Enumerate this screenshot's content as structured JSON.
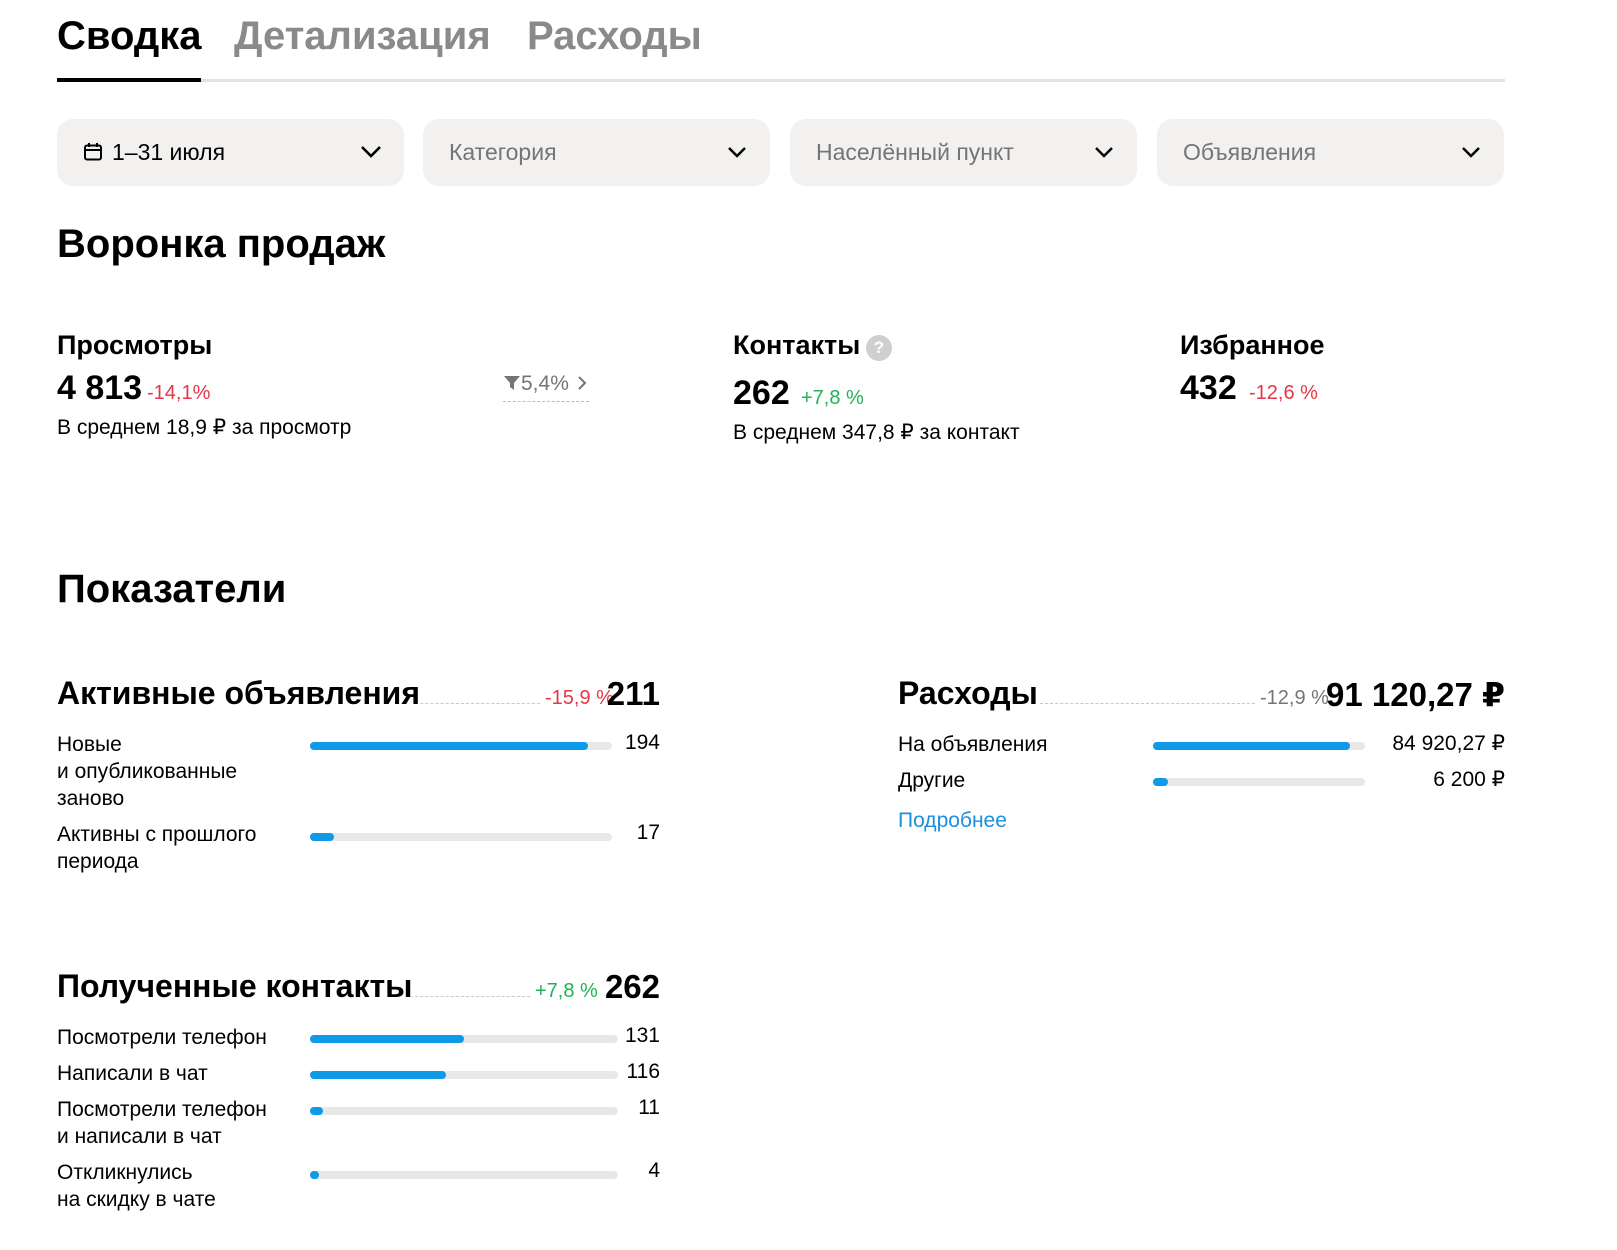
{
  "tabs": [
    {
      "label": "Сводка",
      "active": true
    },
    {
      "label": "Детализация",
      "active": false
    },
    {
      "label": "Расходы",
      "active": false
    }
  ],
  "filters": {
    "date": "1–31 июля",
    "category_placeholder": "Категория",
    "city_placeholder": "Населённый пункт",
    "ads_placeholder": "Объявления"
  },
  "funnel": {
    "title": "Воронка продаж",
    "views": {
      "title": "Просмотры",
      "value": "4 813",
      "change": "-14,1%",
      "avg": "В среднем 18,9 ₽ за просмотр",
      "conversion": "5,4%"
    },
    "contacts": {
      "title": "Контакты",
      "help": "?",
      "value": "262",
      "change": "+7,8 %",
      "avg": "В среднем 347,8 ₽ за контакт"
    },
    "favorites": {
      "title": "Избранное",
      "value": "432",
      "change": "-12,6 %"
    }
  },
  "indicators": {
    "title": "Показатели",
    "active_ads": {
      "title": "Активные объявления",
      "change": "-15,9 %",
      "value": "211",
      "rows": [
        {
          "label1": "Новые",
          "label2": "и опубликованные",
          "label3": "заново",
          "value": "194",
          "fraction": 0.92
        },
        {
          "label1": "Активны с прошлого",
          "label2": "периода",
          "value": "17",
          "fraction": 0.08
        }
      ]
    },
    "expenses": {
      "title": "Расходы",
      "change": "-12,9 %",
      "value": "91 120,27 ₽",
      "rows": [
        {
          "label": "На объявления",
          "value": "84 920,27 ₽",
          "fraction": 0.93
        },
        {
          "label": "Другие",
          "value": "6 200 ₽",
          "fraction": 0.07
        }
      ],
      "more_link": "Подробнее"
    },
    "contacts": {
      "title": "Полученные контакты",
      "change": "+7,8 %",
      "value": "262",
      "rows": [
        {
          "label1": "Посмотрели телефон",
          "value": "131",
          "fraction": 0.5
        },
        {
          "label1": "Написали в чат",
          "value": "116",
          "fraction": 0.443
        },
        {
          "label1": "Посмотрели телефон",
          "label2": "и написали в чат",
          "value": "11",
          "fraction": 0.042
        },
        {
          "label1": "Откликнулись",
          "label2": "на скидку в чате",
          "value": "4",
          "fraction": 0.015
        }
      ]
    }
  }
}
